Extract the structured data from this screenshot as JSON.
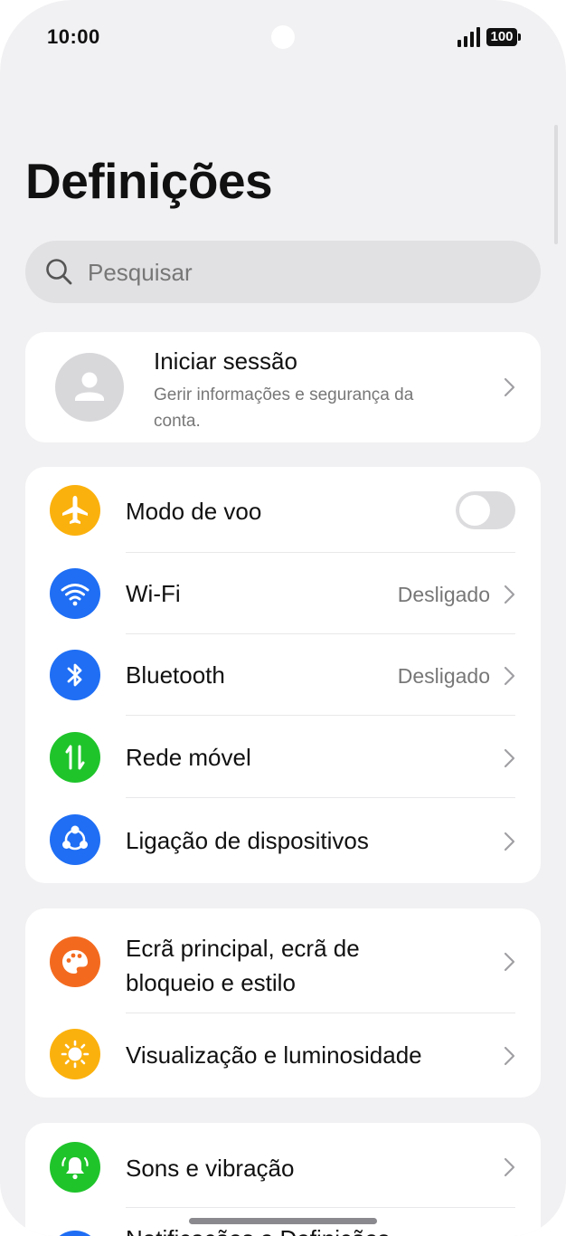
{
  "status_bar": {
    "time": "10:00",
    "battery": "100"
  },
  "page_title": "Definições",
  "search": {
    "placeholder": "Pesquisar"
  },
  "account": {
    "title": "Iniciar sessão",
    "subtitle": "Gerir informações e segurança da conta."
  },
  "connectivity": {
    "airplane": {
      "label": "Modo de voo",
      "icon": "airplane-icon",
      "color": "#FBB10D",
      "enabled": false
    },
    "wifi": {
      "label": "Wi-Fi",
      "value": "Desligado",
      "icon": "wifi-icon",
      "color": "#1F6EF4"
    },
    "bluetooth": {
      "label": "Bluetooth",
      "value": "Desligado",
      "icon": "bluetooth-icon",
      "color": "#1F6EF4"
    },
    "mobile_network": {
      "label": "Rede móvel",
      "icon": "mobile-data-icon",
      "color": "#1FC42B"
    },
    "device_connection": {
      "label": "Ligação de dispositivos",
      "icon": "device-connection-icon",
      "color": "#1F6EF4"
    }
  },
  "appearance": {
    "home_screen": {
      "label_line1": "Ecrã principal, ecrã de",
      "label_line2": "bloqueio e estilo",
      "icon": "palette-icon",
      "color": "#F36A1F"
    },
    "display": {
      "label": "Visualização e luminosidade",
      "icon": "brightness-icon",
      "color": "#FBB10D"
    }
  },
  "sound": {
    "sounds": {
      "label": "Sons e vibração",
      "icon": "bell-icon",
      "color": "#1FC42B"
    },
    "peek_label": "Notificações e Definições"
  }
}
